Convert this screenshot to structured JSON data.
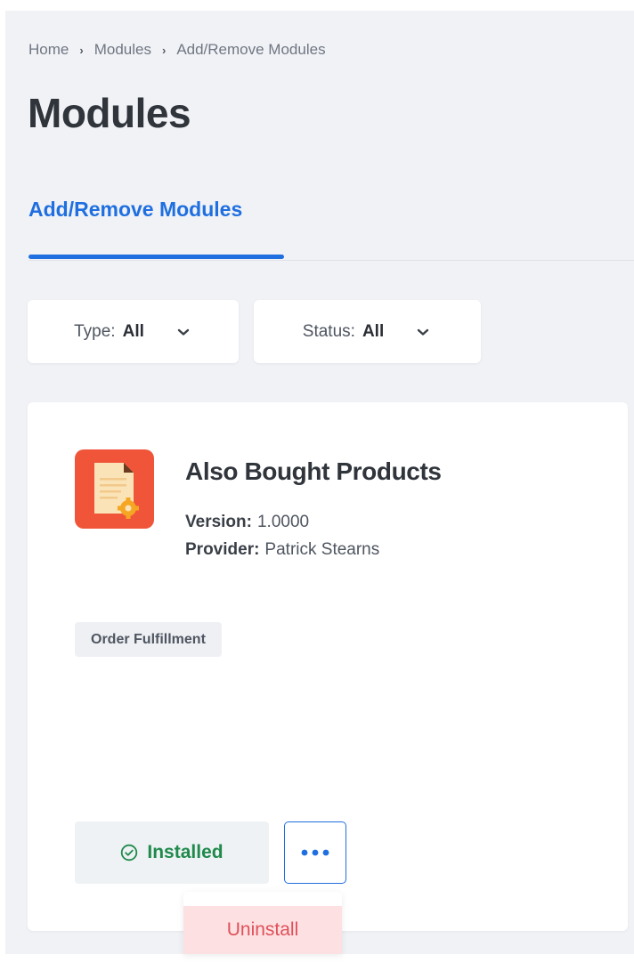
{
  "breadcrumb": {
    "items": [
      "Home",
      "Modules",
      "Add/Remove Modules"
    ],
    "separator": "›"
  },
  "page": {
    "title": "Modules"
  },
  "tabs": [
    {
      "label": "Add/Remove Modules",
      "active": true
    }
  ],
  "filters": {
    "type": {
      "label": "Type:",
      "value": "All"
    },
    "status": {
      "label": "Status:",
      "value": "All"
    }
  },
  "module": {
    "name": "Also Bought Products",
    "version_label": "Version:",
    "version": "1.0000",
    "provider_label": "Provider:",
    "provider": "Patrick Stearns",
    "category": "Order Fulfillment",
    "status": "Installed",
    "icon": "document-gear-icon"
  },
  "menu": {
    "uninstall_label": "Uninstall"
  },
  "colors": {
    "accent": "#1f6fe0",
    "success": "#1f8a4c",
    "danger": "#e0505a",
    "module_icon_bg": "#f0553a",
    "page_bg": "#f1f2f6"
  }
}
